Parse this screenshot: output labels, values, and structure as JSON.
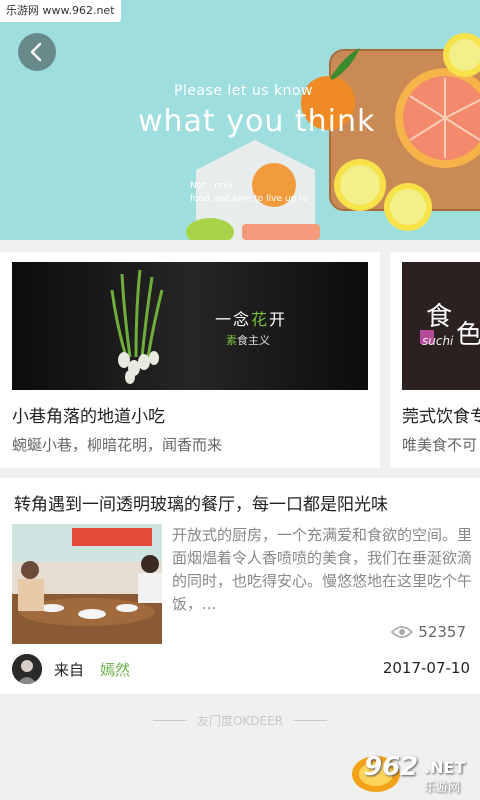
{
  "watermark_top": "乐游网 www.962.net",
  "hero": {
    "subtitle": "Please let us know",
    "title": "what you think",
    "caption_line1": "Not · only",
    "caption_line2": "food and love to live up to"
  },
  "cards": [
    {
      "image_text_1_pre": "一念",
      "image_text_1_hl": "花",
      "image_text_1_post": "开",
      "image_text_2_hl": "素",
      "image_text_2_post": "食主义",
      "title": "小巷角落的地道小吃",
      "desc": "蜿蜒小巷，柳暗花明，闻香而来"
    },
    {
      "image_text_a": "食",
      "image_text_b": "色",
      "image_text_c": "suchi",
      "title": "莞式饮食专",
      "desc": "唯美食不可"
    }
  ],
  "article": {
    "title": "转角遇到一间透明玻璃的餐厅，每一口都是阳光味",
    "body": "开放式的厨房，一个充满爱和食欲的空间。里面烟煴着令人香喷喷的美食，我们在垂涎欲滴的同时，也吃得安心。慢悠悠地在这里吃个午饭，...",
    "views": "52357",
    "from_label": "来自",
    "author": "嫣然",
    "date": "2017-07-10"
  },
  "footer_mark": "友门度OKDEER",
  "watermark_bottom": {
    "number": "962",
    "suffix": ".NET",
    "sub": "乐游网"
  },
  "colors": {
    "accent_green": "#6ab04c",
    "hero_bg": "#9fdede"
  },
  "icons": {
    "back": "chevron-left-icon",
    "views": "eye-icon"
  }
}
